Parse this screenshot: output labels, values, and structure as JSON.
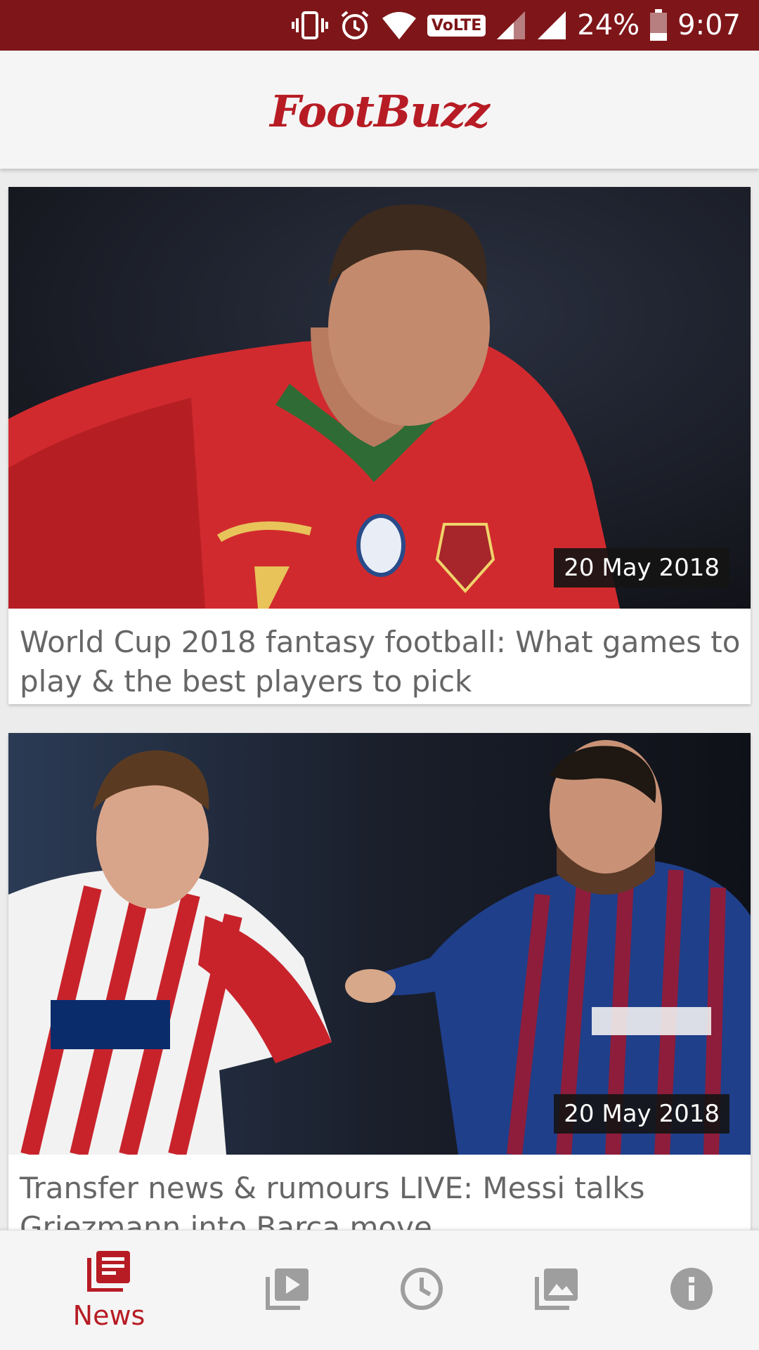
{
  "status_bar": {
    "battery_percent": "24%",
    "time": "9:07",
    "volte_label": "VoLTE",
    "icons": [
      "vibrate-icon",
      "alarm-icon",
      "wifi-icon",
      "volte-icon",
      "signal-icon",
      "signal-icon",
      "battery-icon"
    ]
  },
  "app_bar": {
    "title": "FootBuzz",
    "brand_color": "#b71c24"
  },
  "articles": [
    {
      "date": "20 May 2018",
      "title": "World Cup 2018 fantasy football: What games to play & the best players to pick",
      "image": "footballer-in-red-jersey-photo"
    },
    {
      "date": "20 May 2018",
      "title": "Transfer news & rumours LIVE: Messi talks Griezmann into Barca move",
      "image": "two-footballers-photo"
    }
  ],
  "bottom_nav": {
    "active_color": "#b71c24",
    "inactive_color": "#9e9e9e",
    "items": [
      {
        "icon": "news-icon",
        "label": "News",
        "active": true
      },
      {
        "icon": "video-library-icon",
        "active": false
      },
      {
        "icon": "clock-icon",
        "active": false
      },
      {
        "icon": "photo-library-icon",
        "active": false
      },
      {
        "icon": "info-icon",
        "active": false
      }
    ]
  }
}
